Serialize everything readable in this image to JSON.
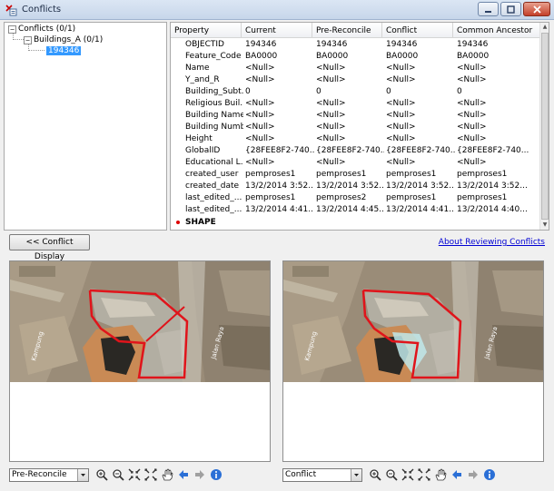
{
  "window": {
    "title": "Conflicts"
  },
  "tree": {
    "root": "Conflicts (0/1)",
    "child": "Buildings_A (0/1)",
    "leaf": "194346"
  },
  "grid": {
    "columns": [
      "Property",
      "Current",
      "Pre-Reconcile",
      "Conflict",
      "Common Ancestor"
    ],
    "rows": [
      [
        "OBJECTID",
        "194346",
        "194346",
        "194346",
        "194346"
      ],
      [
        "Feature_Code",
        "BA0000",
        "BA0000",
        "BA0000",
        "BA0000"
      ],
      [
        "Name",
        "<Null>",
        "<Null>",
        "<Null>",
        "<Null>"
      ],
      [
        "Y_and_R",
        "<Null>",
        "<Null>",
        "<Null>",
        "<Null>"
      ],
      [
        "Building_Subt...",
        "0",
        "0",
        "0",
        "0"
      ],
      [
        "Religious Buil...",
        "<Null>",
        "<Null>",
        "<Null>",
        "<Null>"
      ],
      [
        "Building Name",
        "<Null>",
        "<Null>",
        "<Null>",
        "<Null>"
      ],
      [
        "Building Number",
        "<Null>",
        "<Null>",
        "<Null>",
        "<Null>"
      ],
      [
        "Height",
        "<Null>",
        "<Null>",
        "<Null>",
        "<Null>"
      ],
      [
        "GlobalID",
        "{28FEE8F2-740...",
        "{28FEE8F2-740...",
        "{28FEE8F2-740...",
        "{28FEE8F2-740..."
      ],
      [
        "Educational L...",
        "<Null>",
        "<Null>",
        "<Null>",
        "<Null>"
      ],
      [
        "created_user",
        "pemproses1",
        "pemproses1",
        "pemproses1",
        "pemproses1"
      ],
      [
        "created_date",
        "13/2/2014 3:52...",
        "13/2/2014 3:52...",
        "13/2/2014 3:52...",
        "13/2/2014 3:52..."
      ],
      [
        "last_edited_...",
        "pemproses1",
        "pemproses2",
        "pemproses1",
        "pemproses1"
      ],
      [
        "last_edited_...",
        "13/2/2014 4:41...",
        "13/2/2014 4:45...",
        "13/2/2014 4:41...",
        "13/2/2014 4:40..."
      ]
    ],
    "shape_label": "SHAPE"
  },
  "buttons": {
    "conflict_display": "<< Conflict Display",
    "about_link": "About Reviewing Conflicts"
  },
  "left_map": {
    "view": "Pre-Reconcile",
    "street_left": "Kampung",
    "street_right": "Jalan Raya"
  },
  "right_map": {
    "view": "Conflict",
    "street_left": "Kampung",
    "street_right": "Jalan Raya"
  },
  "colors": {
    "selection": "#3399ff",
    "outline": "#e0141b",
    "link": "#0000d4"
  },
  "icons": [
    "zoom-in-icon",
    "zoom-out-icon",
    "fixed-zoom-in-icon",
    "fixed-zoom-out-icon",
    "pan-icon",
    "back-arrow-icon",
    "forward-arrow-icon",
    "info-icon"
  ]
}
